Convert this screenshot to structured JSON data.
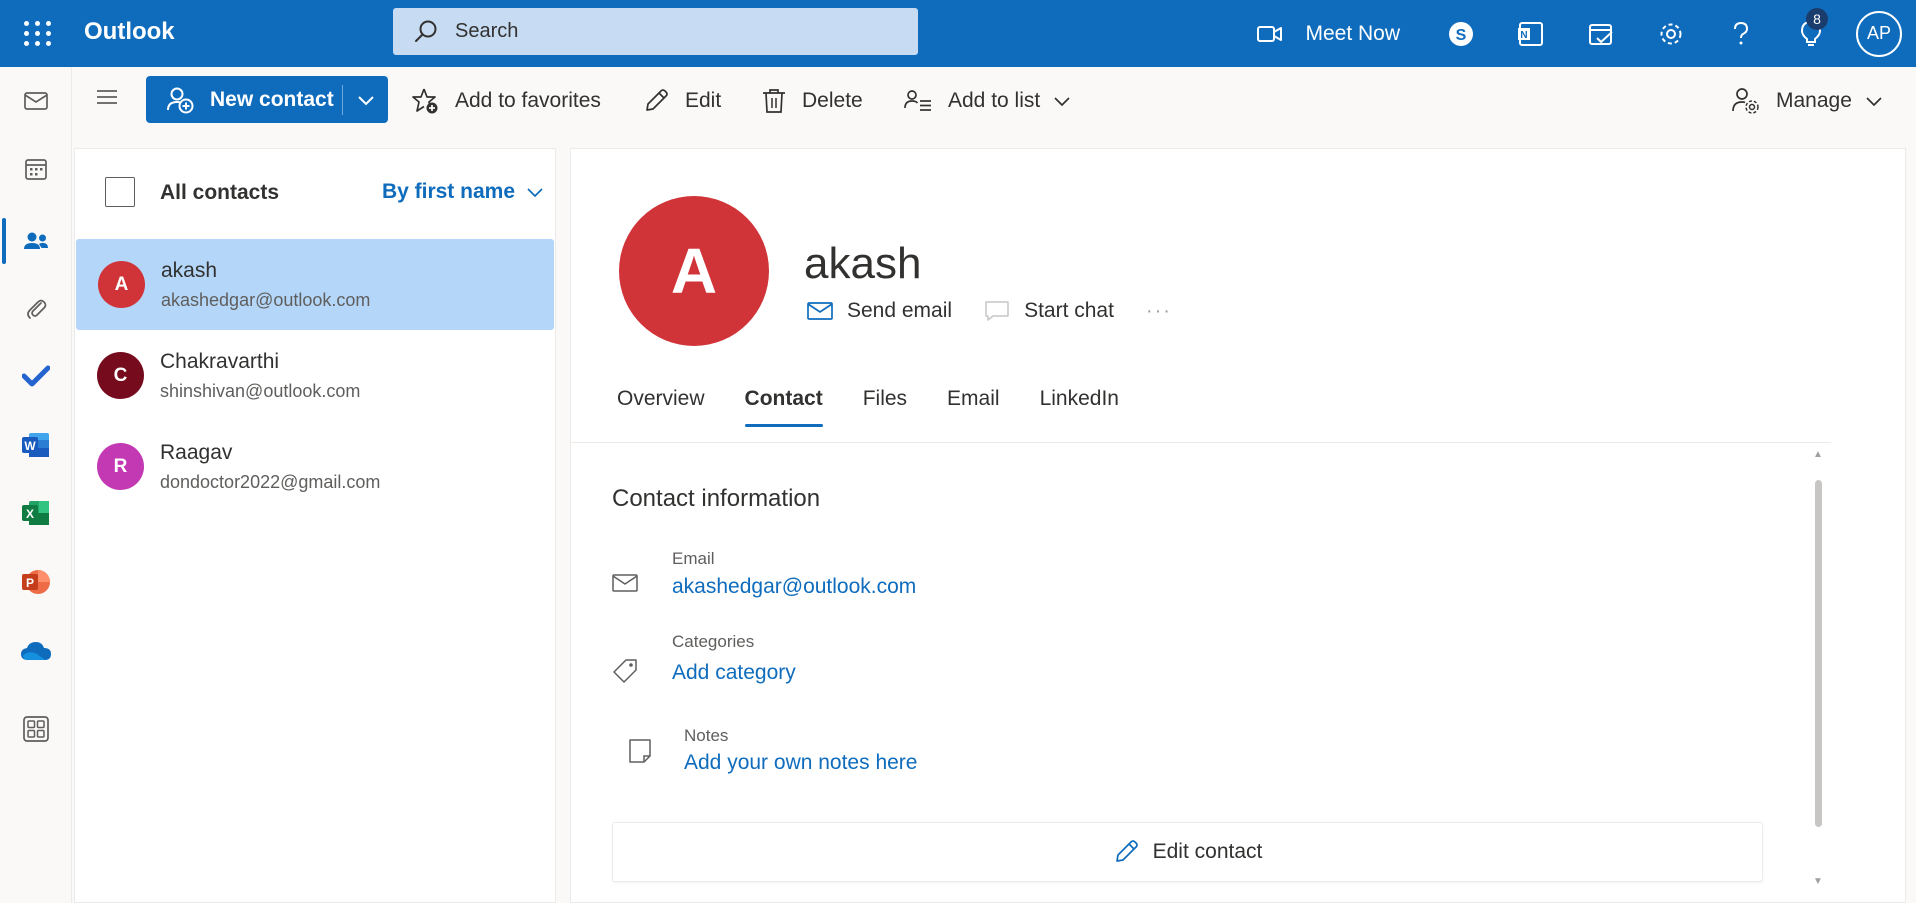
{
  "app": {
    "title": "Outlook"
  },
  "search": {
    "placeholder": "Search"
  },
  "topbar": {
    "meet_now_label": "Meet Now",
    "notifications_badge": "8",
    "user_initials": "AP",
    "icons": [
      "video-icon",
      "skype-icon",
      "onenote-icon",
      "calendar-check-icon",
      "gear-icon",
      "help-icon",
      "lightbulb-icon"
    ]
  },
  "rail": {
    "items": [
      "mail-icon",
      "calendar-icon",
      "people-icon",
      "paperclip-icon",
      "todo-icon",
      "word-icon",
      "excel-icon",
      "powerpoint-icon",
      "onedrive-icon",
      "apps-icon"
    ],
    "active": "people-icon"
  },
  "toolbar": {
    "new_contact": "New contact",
    "add_to_favorites": "Add to favorites",
    "edit": "Edit",
    "delete": "Delete",
    "add_to_list": "Add to list",
    "manage": "Manage"
  },
  "list": {
    "header": "All contacts",
    "sort_label": "By first name",
    "contacts": [
      {
        "initial": "A",
        "name": "akash",
        "email": "akashedgar@outlook.com",
        "color": "#d13438",
        "selected": true
      },
      {
        "initial": "C",
        "name": "Chakravarthi",
        "email": "shinshivan@outlook.com",
        "color": "#750b1c",
        "selected": false
      },
      {
        "initial": "R",
        "name": "Raagav",
        "email": "dondoctor2022@gmail.com",
        "color": "#c239b3",
        "selected": false
      }
    ]
  },
  "detail": {
    "initial": "A",
    "name": "akash",
    "avatar_color": "#d13438",
    "send_email": "Send email",
    "start_chat": "Start chat",
    "more": "···",
    "tabs": [
      "Overview",
      "Contact",
      "Files",
      "Email",
      "LinkedIn"
    ],
    "active_tab": "Contact",
    "section_title": "Contact information",
    "email_label": "Email",
    "email_value": "akashedgar@outlook.com",
    "categories_label": "Categories",
    "categories_value": "Add category",
    "notes_label": "Notes",
    "notes_value": "Add your own notes here",
    "edit_contact": "Edit contact"
  },
  "colors": {
    "brand": "#0f6cbd",
    "search_bg": "#c7dbf2",
    "selected_row": "#b3d6f9"
  }
}
